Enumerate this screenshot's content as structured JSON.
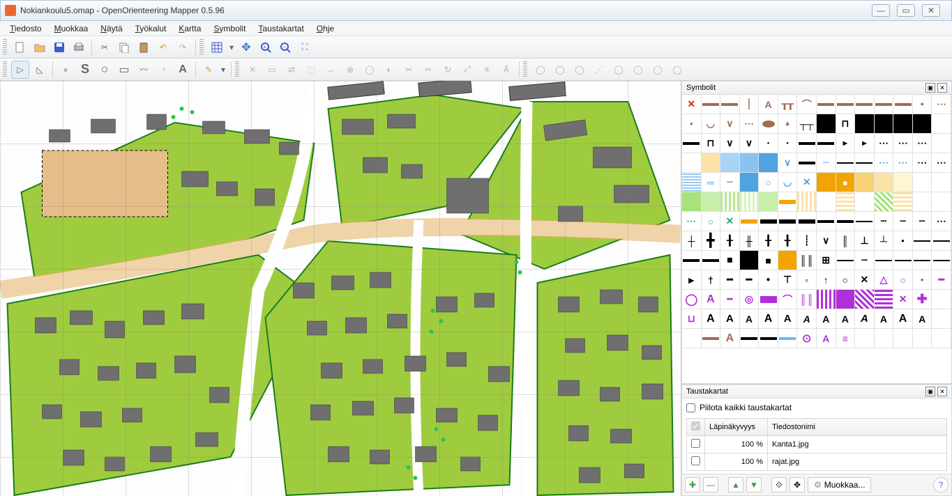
{
  "title": "Nokiankoulu5.omap - OpenOrienteering Mapper 0.5.96",
  "menu": [
    "Tiedosto",
    "Muokkaa",
    "Näytä",
    "Työkalut",
    "Kartta",
    "Symbolit",
    "Taustakartat",
    "Ohje"
  ],
  "panels": {
    "symbols_title": "Symbolit",
    "templates_title": "Taustakartat",
    "hide_all_label": "Piilota kaikki taustakartat",
    "col_opacity": "Läpinäkyvyys",
    "col_filename": "Tiedostonimi",
    "rows": [
      {
        "opacity": "100 %",
        "file": "Kanta1.jpg"
      },
      {
        "opacity": "100 %",
        "file": "rajat.jpg"
      }
    ],
    "edit_label": "Muokkaa..."
  },
  "symbol_cells": [
    {
      "t": "✕",
      "c": "#cc3300"
    },
    {
      "bg": "#a36b4f",
      "h": 2
    },
    {
      "bg": "#a36b4f",
      "h": 2
    },
    {
      "t": "┊",
      "c": "#a36b4f"
    },
    {
      "t": "A",
      "c": "#a36b4f"
    },
    {
      "t": "┰┰",
      "c": "#a36b4f"
    },
    {
      "t": "⌒",
      "c": "#a36b4f"
    },
    {
      "bg": "#a36b4f",
      "h": 2
    },
    {
      "bg": "#a36b4f",
      "h": 2
    },
    {
      "bg": "#a36b4f",
      "h": 2
    },
    {
      "bg": "#a36b4f",
      "h": 2
    },
    {
      "bg": "#a36b4f",
      "h": 2
    },
    {
      "t": "◆",
      "c": "#a36b4f",
      "sz": 6
    },
    {
      "t": "⋯",
      "c": "#a36b4f"
    },
    {
      "t": "●",
      "c": "#a36b4f",
      "sz": 8
    },
    {
      "t": "◡",
      "c": "#a36b4f"
    },
    {
      "t": "∨",
      "c": "#a36b4f"
    },
    {
      "t": "⋯",
      "c": "#a36b4f"
    },
    {
      "bg": "#a36b4f",
      "shape": "ellipse"
    },
    {
      "t": "▲",
      "c": "#a36b4f",
      "sz": 10
    },
    {
      "t": "┬┬",
      "c": "#000"
    },
    {
      "bg": "#000"
    },
    {
      "t": "⊓",
      "c": "#000"
    },
    {
      "bg": "#000"
    },
    {
      "bg": "#000"
    },
    {
      "bg": "#000"
    },
    {
      "bg": "#000"
    },
    {
      "t": ""
    },
    {
      "bg": "#000",
      "h": 2
    },
    {
      "t": "⊓",
      "c": "#000"
    },
    {
      "t": "∨",
      "c": "#000"
    },
    {
      "t": "∨",
      "c": "#000"
    },
    {
      "t": "●",
      "c": "#000",
      "sz": 6
    },
    {
      "t": "●",
      "c": "#000",
      "sz": 6
    },
    {
      "bg": "#000",
      "h": 2
    },
    {
      "bg": "#000",
      "h": 2
    },
    {
      "t": "▶",
      "c": "#000",
      "sz": 8
    },
    {
      "t": "▶",
      "c": "#000",
      "sz": 8
    },
    {
      "t": "⋯",
      "c": "#000"
    },
    {
      "t": "⋯",
      "c": "#000"
    },
    {
      "t": "⋯",
      "c": "#000"
    },
    {
      "t": ""
    },
    {
      "t": ""
    },
    {
      "bg": "#fbe2a8"
    },
    {
      "bg": "#aad4f5"
    },
    {
      "bg": "#8cc2ef"
    },
    {
      "bg": "#4fa3e0"
    },
    {
      "t": "∨",
      "c": "#4fa3e0"
    },
    {
      "bg": "#000",
      "h": 2
    },
    {
      "t": "┄",
      "c": "#8cc2ef"
    },
    {
      "bg": "#000",
      "h": 1
    },
    {
      "bg": "#000",
      "h": 1
    },
    {
      "t": "⋯",
      "c": "#4fa3e0"
    },
    {
      "t": "⋯",
      "c": "#4fa3e0"
    },
    {
      "t": "⋯",
      "c": "#000"
    },
    {
      "t": "⋯",
      "c": "#000"
    },
    {
      "bg": "#97caf2",
      "stripes": true
    },
    {
      "t": "═",
      "c": "#4fa3e0"
    },
    {
      "t": "┄",
      "c": "#4fa3e0"
    },
    {
      "bg": "#4fa3e0"
    },
    {
      "t": "○",
      "c": "#4fa3e0"
    },
    {
      "t": "◡",
      "c": "#4fa3e0"
    },
    {
      "t": "✕",
      "c": "#4fa3e0"
    },
    {
      "bg": "#f2a400"
    },
    {
      "bg": "#f2a400",
      "dot": "#fff"
    },
    {
      "bg": "#f5d274"
    },
    {
      "bg": "#fbe2a8"
    },
    {
      "bg": "#fff4d4"
    },
    {
      "t": ""
    },
    {
      "t": ""
    },
    {
      "bg": "#a7e27a"
    },
    {
      "bg": "#c7efaa"
    },
    {
      "bg": "#b8e890",
      "stripes": "v"
    },
    {
      "bg": "#d5f3bd",
      "stripes": "v"
    },
    {
      "bg": "#c7efaa"
    },
    {
      "bg": "#f2a400",
      "h": 3
    },
    {
      "bg": "#fbe2a8",
      "stripes": "v"
    },
    {
      "bg": "#fff",
      "stripes": "v"
    },
    {
      "bg": "#fbe2a8",
      "stripes": "g"
    },
    {
      "bg": "#fff",
      "stripes": "g"
    },
    {
      "bg": "#a7e27a",
      "stripes": "d"
    },
    {
      "bg": "#fbe2a8",
      "stripes": "g"
    },
    {
      "bg": "#fff",
      "stripes": "g"
    },
    {
      "t": ""
    },
    {
      "t": "⋯",
      "c": "#2a7"
    },
    {
      "t": "○",
      "c": "#2a7"
    },
    {
      "t": "✕",
      "c": "#2a7"
    },
    {
      "bg": "#f2a400",
      "h": 3
    },
    {
      "bg": "#000",
      "h": 3
    },
    {
      "bg": "#000",
      "h": 3
    },
    {
      "bg": "#000",
      "h": 3
    },
    {
      "bg": "#000",
      "h": 2
    },
    {
      "bg": "#000",
      "h": 2
    },
    {
      "bg": "#000",
      "h": 1
    },
    {
      "t": "┄",
      "c": "#000"
    },
    {
      "t": "┄",
      "c": "#000"
    },
    {
      "t": "┄",
      "c": "#000"
    },
    {
      "t": "⋯",
      "c": "#000"
    },
    {
      "t": "┼",
      "c": "#000"
    },
    {
      "t": "╋",
      "c": "#000",
      "sz": 18
    },
    {
      "t": "╂",
      "c": "#000"
    },
    {
      "t": "╫",
      "c": "#000"
    },
    {
      "t": "╂",
      "c": "#000"
    },
    {
      "t": "╂",
      "c": "#000"
    },
    {
      "t": "┊",
      "c": "#000"
    },
    {
      "t": "∨",
      "c": "#000"
    },
    {
      "t": "║",
      "c": "#000"
    },
    {
      "t": "⊥",
      "c": "#000"
    },
    {
      "t": "┴",
      "c": "#000"
    },
    {
      "t": "●",
      "c": "#000",
      "sz": 8
    },
    {
      "bg": "#000",
      "h": 1
    },
    {
      "bg": "#000",
      "h": 1
    },
    {
      "bg": "#000",
      "h": 2
    },
    {
      "bg": "#000",
      "h": 2
    },
    {
      "t": "◼",
      "c": "#000",
      "sz": 10
    },
    {
      "bg": "#000"
    },
    {
      "t": "■",
      "c": "#000",
      "sz": 14
    },
    {
      "bg": "#f2a400"
    },
    {
      "t": "║║",
      "c": "#000"
    },
    {
      "t": "⊞",
      "c": "#000"
    },
    {
      "bg": "#000",
      "h": 1
    },
    {
      "t": "┄",
      "c": "#000"
    },
    {
      "bg": "#000",
      "h": 1
    },
    {
      "bg": "#000",
      "h": 1
    },
    {
      "bg": "#000",
      "h": 1
    },
    {
      "bg": "#000",
      "h": 1
    },
    {
      "t": "►",
      "c": "#000"
    },
    {
      "t": "†",
      "c": "#000"
    },
    {
      "t": "━",
      "c": "#000"
    },
    {
      "t": "━",
      "c": "#000"
    },
    {
      "t": "●",
      "c": "#000",
      "sz": 10
    },
    {
      "t": "⊤",
      "c": "#000"
    },
    {
      "t": "◦",
      "c": "#000"
    },
    {
      "t": "↑",
      "c": "#000"
    },
    {
      "t": "○",
      "c": "#000"
    },
    {
      "t": "✕",
      "c": "#000"
    },
    {
      "t": "△",
      "c": "#b030d8",
      "sz": 14
    },
    {
      "t": "○",
      "c": "#b030d8",
      "sz": 14
    },
    {
      "t": "●",
      "c": "#b030d8",
      "sz": 8
    },
    {
      "t": "━",
      "c": "#b030d8"
    },
    {
      "t": "◯",
      "c": "#b030d8",
      "sz": 16
    },
    {
      "t": "A",
      "c": "#b030d8",
      "sz": 16
    },
    {
      "t": "┅",
      "c": "#b030d8"
    },
    {
      "t": "◎",
      "c": "#b030d8"
    },
    {
      "bg": "#b030d8",
      "h": 5
    },
    {
      "t": "⌒",
      "c": "#b030d8"
    },
    {
      "t": "║║",
      "c": "#b030d8"
    },
    {
      "bg": "#b030d8",
      "stripes": "v"
    },
    {
      "bg": "#b030d8"
    },
    {
      "bg": "#b030d8",
      "stripes": "d"
    },
    {
      "bg": "#b030d8",
      "stripes": "g"
    },
    {
      "t": "✕",
      "c": "#b030d8"
    },
    {
      "t": "✚",
      "c": "#b030d8",
      "sz": 18
    },
    {
      "t": ""
    },
    {
      "t": "⊔",
      "c": "#b030d8"
    },
    {
      "t": "A",
      "c": "#000",
      "sz": 16
    },
    {
      "t": "A",
      "c": "#000",
      "sz": 15
    },
    {
      "t": "A",
      "c": "#000",
      "sz": 14
    },
    {
      "t": "A",
      "c": "#000",
      "sz": 16,
      "b": true
    },
    {
      "t": "A",
      "c": "#000",
      "sz": 15,
      "b": true
    },
    {
      "t": "A",
      "c": "#000",
      "sz": 14,
      "i": true
    },
    {
      "t": "A",
      "c": "#000",
      "sz": 14
    },
    {
      "t": "A",
      "c": "#000",
      "sz": 14,
      "b": true
    },
    {
      "t": "A",
      "c": "#000",
      "sz": 15,
      "i": true
    },
    {
      "t": "A",
      "c": "#000",
      "sz": 14
    },
    {
      "t": "A",
      "c": "#000",
      "sz": 16,
      "b": true
    },
    {
      "t": "A",
      "c": "#000",
      "sz": 14
    },
    {
      "t": ""
    },
    {
      "t": ""
    },
    {
      "bg": "#a36b4f",
      "h": 2
    },
    {
      "t": "A",
      "c": "#a36b4f",
      "sz": 16,
      "b": true
    },
    {
      "bg": "#000",
      "h": 2
    },
    {
      "bg": "#000",
      "h": 2
    },
    {
      "bg": "#6bb8e8",
      "h": 2
    },
    {
      "t": "⊙",
      "c": "#b030d8",
      "sz": 16
    },
    {
      "t": "A",
      "c": "#b030d8",
      "sz": 14,
      "b": true
    },
    {
      "t": "≡",
      "c": "#b030d8"
    },
    {
      "t": ""
    },
    {
      "t": ""
    },
    {
      "t": ""
    },
    {
      "t": ""
    },
    {
      "t": ""
    }
  ]
}
